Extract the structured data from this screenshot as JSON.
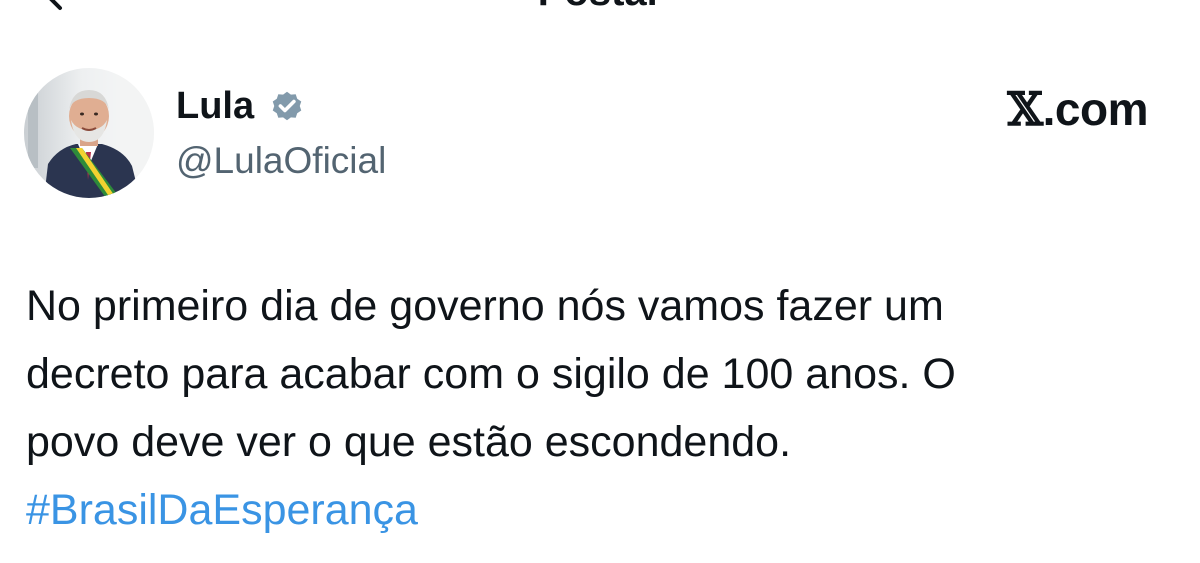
{
  "header": {
    "title": "Postar",
    "back_icon": "arrow-left-icon"
  },
  "author": {
    "display_name": "Lula",
    "handle": "@LulaOficial",
    "verified": true,
    "verified_icon": "verified-badge-icon",
    "verified_color": "#829aab",
    "avatar_icon": "profile-photo"
  },
  "brand": {
    "x_glyph": "𝕏",
    "suffix": ".com"
  },
  "tweet": {
    "lines": [
      "No primeiro dia de governo nós vamos fazer um",
      "decreto para acabar com o sigilo de 100 anos. O",
      "povo deve ver o que estão escondendo."
    ],
    "hashtag": "#BrasilDaEsperança",
    "hashtag_color": "#3a94e4"
  }
}
